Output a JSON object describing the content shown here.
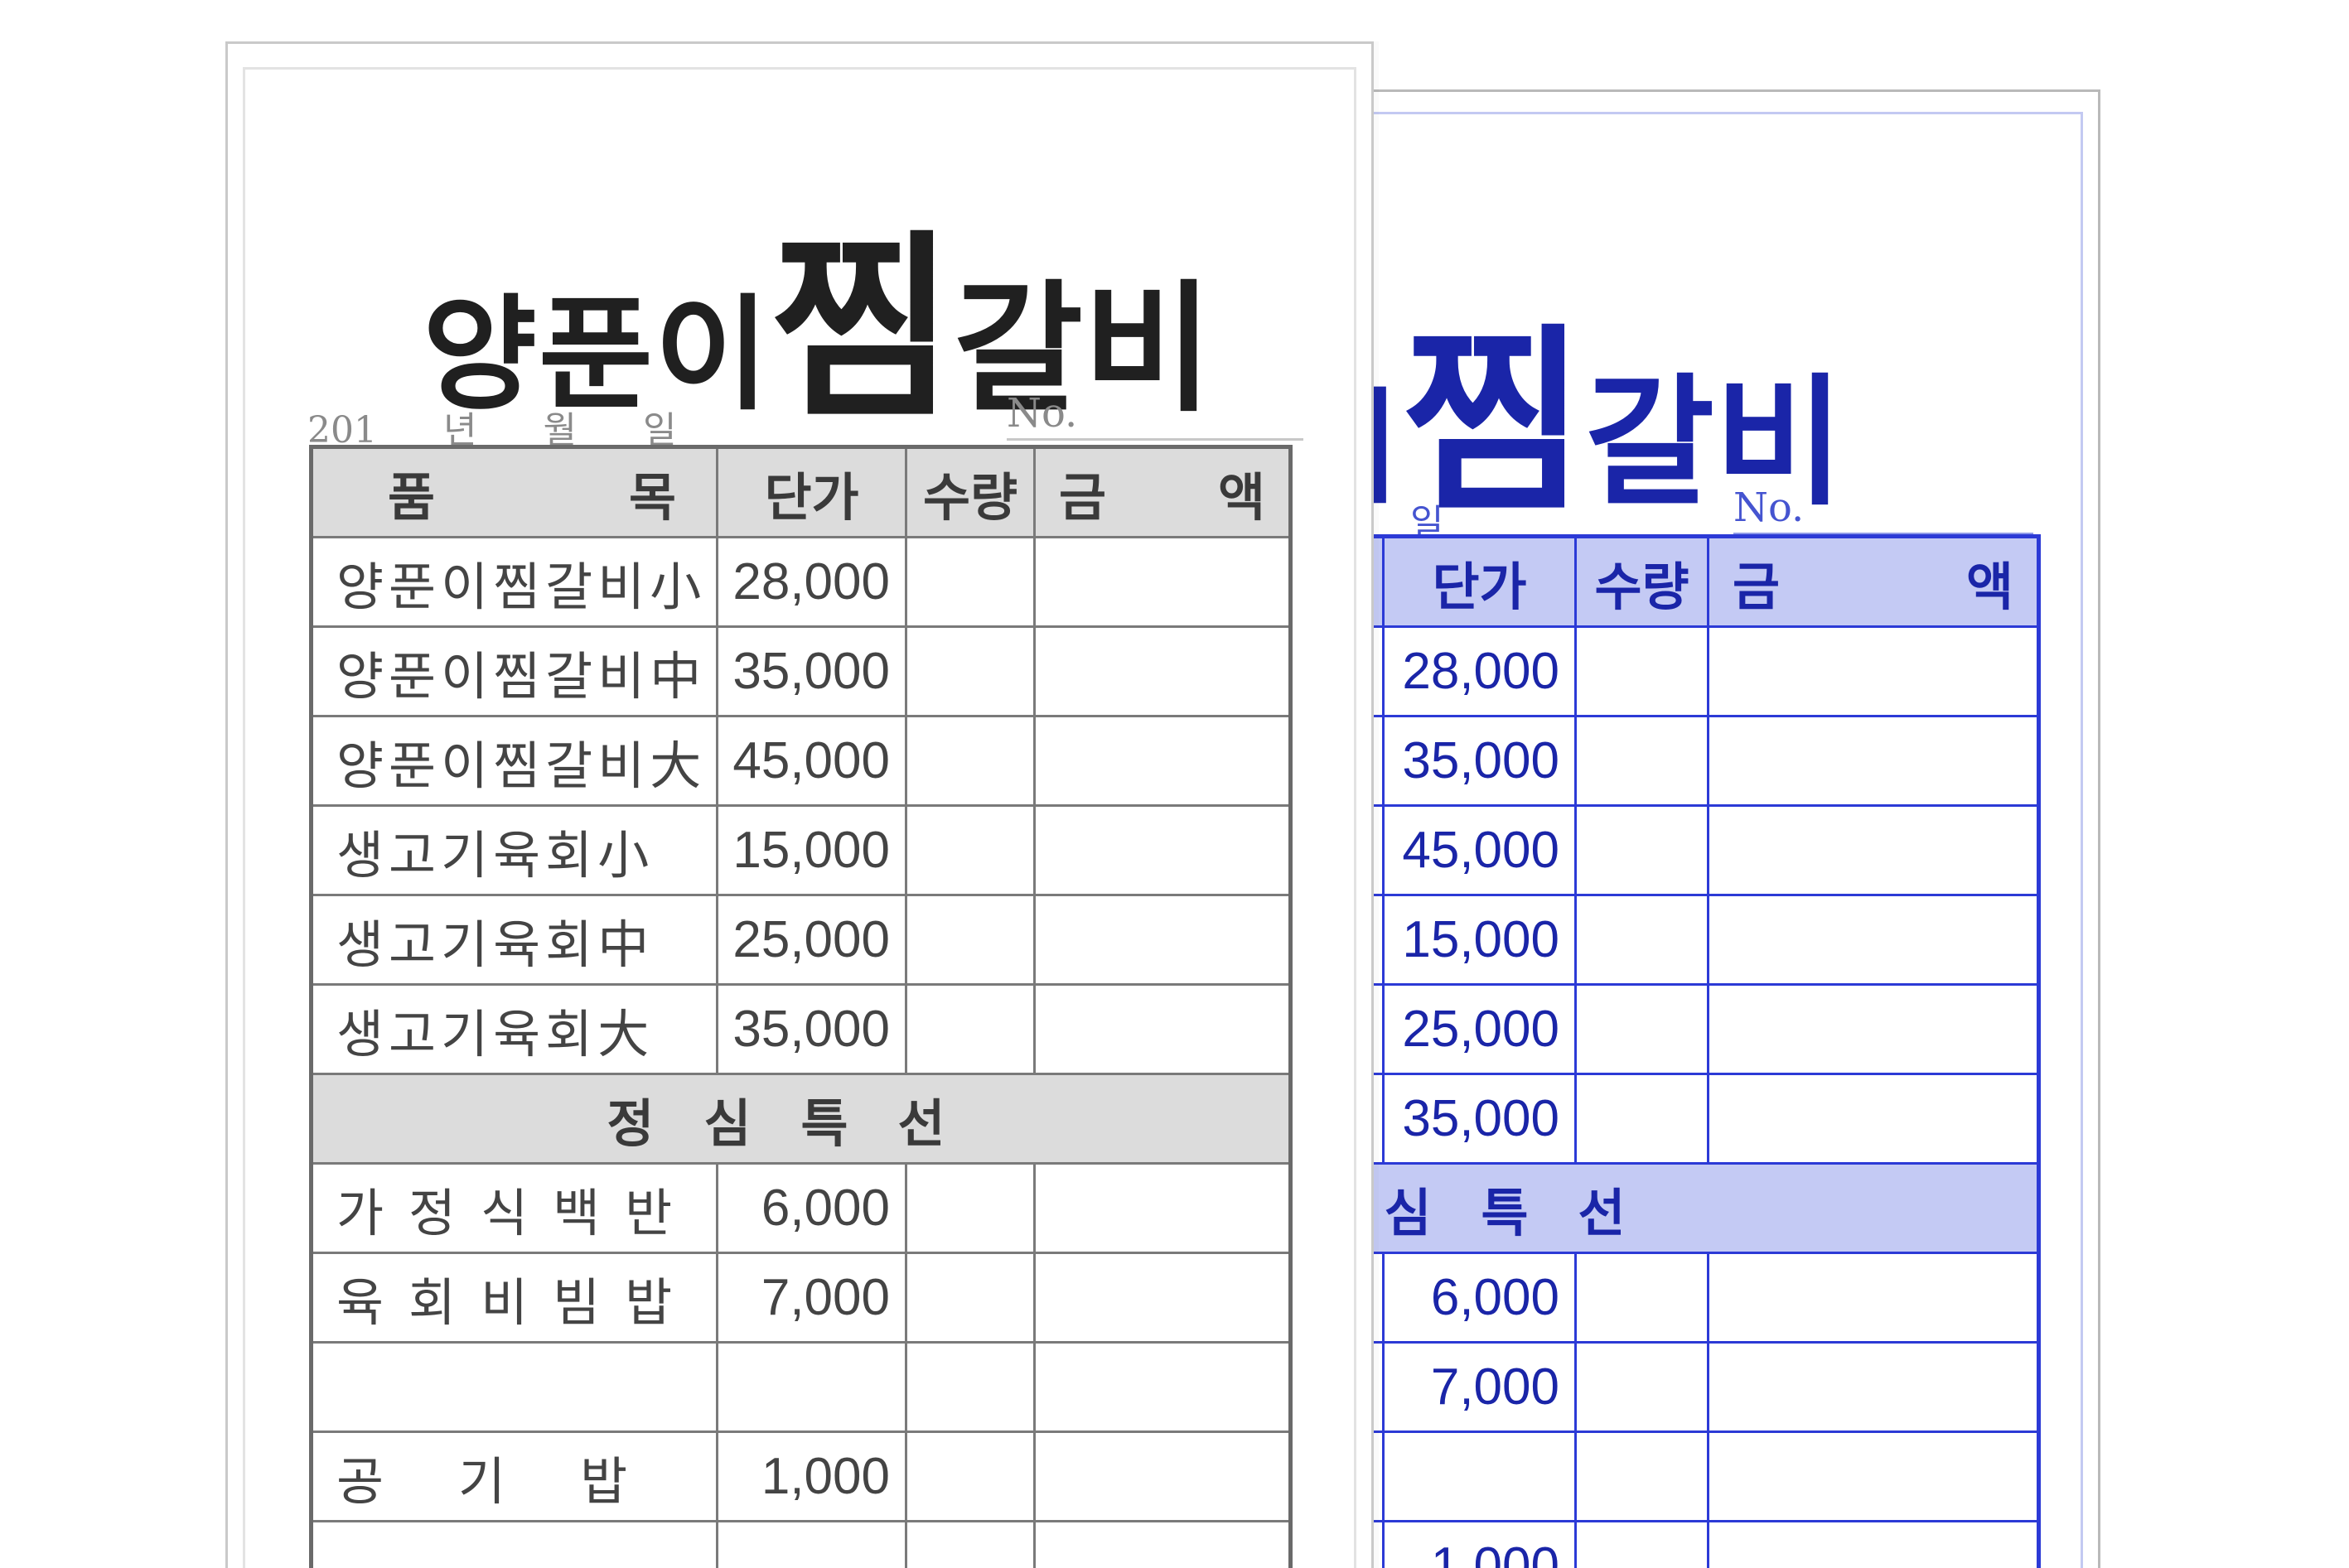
{
  "logo": {
    "part1": "양푼이",
    "part2": "찜",
    "part3": "갈비"
  },
  "date": {
    "year": "201",
    "year_unit": "년",
    "month_unit": "월",
    "day_unit": "일"
  },
  "no_label": "No.",
  "header": {
    "item": [
      "품",
      "목"
    ],
    "price": "단가",
    "qty": "수량",
    "amount": [
      "금",
      "액"
    ]
  },
  "items": [
    {
      "name": "양푼이찜갈비小",
      "price": "28,000"
    },
    {
      "name": "양푼이찜갈비中",
      "price": "35,000"
    },
    {
      "name": "양푼이찜갈비大",
      "price": "45,000"
    },
    {
      "name": "생고기육회小",
      "price": "15,000"
    },
    {
      "name": "생고기육회中",
      "price": "25,000"
    },
    {
      "name": "생고기육회大",
      "price": "35,000"
    }
  ],
  "lunch_special": "정심특선",
  "lunch_items": [
    {
      "name": "가정식백반",
      "price": "6,000"
    },
    {
      "name": "육회비빔밥",
      "price": "7,000"
    },
    {
      "name": "",
      "price": ""
    },
    {
      "name": "공기밥",
      "price": "1,000"
    }
  ],
  "back_visible": {
    "items_suffix": [
      "小",
      "中",
      "大",
      "小",
      "中",
      "大"
    ],
    "lunch_suffix": [
      "반",
      "밥",
      "",
      "밥"
    ],
    "section_partial": "정 심 특 선"
  },
  "colors": {
    "front_ink": "#444444",
    "front_header_bg": "#dcdcdc",
    "back_ink": "#1a25a8",
    "back_header_bg": "#c4caf4",
    "back_line": "#2c3ad6"
  }
}
